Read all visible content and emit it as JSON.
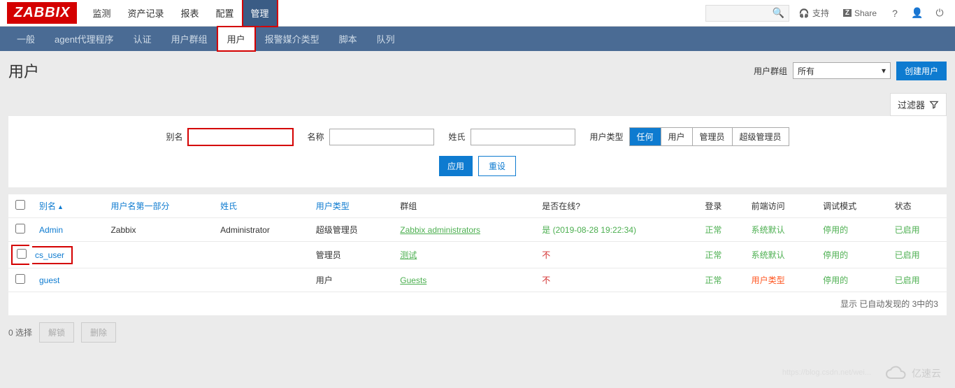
{
  "topbar": {
    "logo": "ZABBIX",
    "menu": [
      "监测",
      "资产记录",
      "报表",
      "配置",
      "管理"
    ],
    "active_menu": 4,
    "support": "支持",
    "share": "Share"
  },
  "subbar": {
    "items": [
      "一般",
      "agent代理程序",
      "认证",
      "用户群组",
      "用户",
      "报警媒介类型",
      "脚本",
      "队列"
    ],
    "active": 4
  },
  "page": {
    "title": "用户",
    "group_label": "用户群组",
    "group_value": "所有",
    "create_btn": "创建用户"
  },
  "filter": {
    "tab_label": "过滤器",
    "alias_label": "别名",
    "name_label": "名称",
    "surname_label": "姓氏",
    "type_label": "用户类型",
    "types": [
      "任何",
      "用户",
      "管理员",
      "超级管理员"
    ],
    "type_active": 0,
    "apply": "应用",
    "reset": "重设"
  },
  "table": {
    "headers": {
      "alias": "别名",
      "firstname": "用户名第一部分",
      "surname": "姓氏",
      "type": "用户类型",
      "groups": "群组",
      "online": "是否在线?",
      "login": "登录",
      "frontend": "前端访问",
      "debug": "调试模式",
      "status": "状态"
    },
    "rows": [
      {
        "alias": "Admin",
        "firstname": "Zabbix",
        "surname": "Administrator",
        "type": "超级管理员",
        "groups": "Zabbix administrators",
        "online": "是 (2019-08-28 19:22:34)",
        "online_class": "green",
        "login": "正常",
        "frontend": "系统默认",
        "frontend_class": "green",
        "debug": "停用的",
        "status": "已启用",
        "hl": false
      },
      {
        "alias": "cs_user",
        "firstname": "",
        "surname": "",
        "type": "管理员",
        "groups": "测试",
        "online": "不",
        "online_class": "red",
        "login": "正常",
        "frontend": "系统默认",
        "frontend_class": "green",
        "debug": "停用的",
        "status": "已启用",
        "hl": true
      },
      {
        "alias": "guest",
        "firstname": "",
        "surname": "",
        "type": "用户",
        "groups": "Guests",
        "online": "不",
        "online_class": "red",
        "login": "正常",
        "frontend": "用户类型",
        "frontend_class": "orange-red",
        "debug": "停用的",
        "status": "已启用",
        "hl": false
      }
    ],
    "footer": "显示 已自动发现的 3中的3"
  },
  "actions": {
    "selected": "0 选择",
    "unlock": "解锁",
    "delete": "删除"
  },
  "watermark": "亿速云",
  "faint_url": "https://blog.csdn.net/wei..."
}
